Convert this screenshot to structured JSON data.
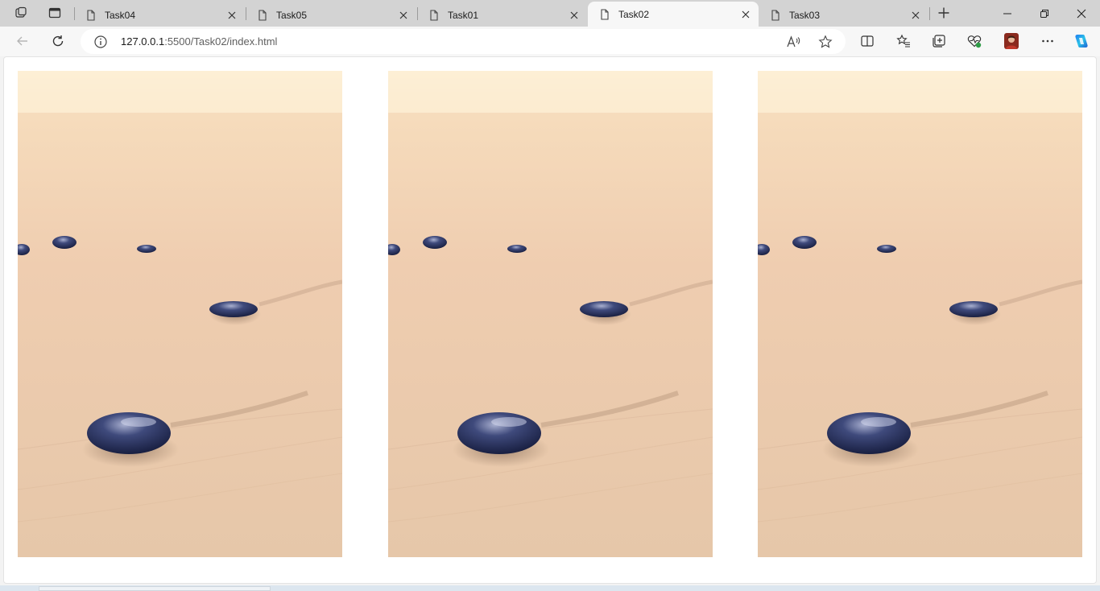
{
  "tabs": [
    {
      "label": "Task04",
      "active": false
    },
    {
      "label": "Task05",
      "active": false
    },
    {
      "label": "Task01",
      "active": false
    },
    {
      "label": "Task02",
      "active": true
    },
    {
      "label": "Task03",
      "active": false
    }
  ],
  "address": {
    "host": "127.0.0.1",
    "path": ":5500/Task02/index.html"
  },
  "colors": {
    "sand_top": "#fbecd3",
    "sand_mid": "#efcfb3",
    "sand_bottom": "#e8c9ac",
    "stone": "#2f3a66"
  }
}
